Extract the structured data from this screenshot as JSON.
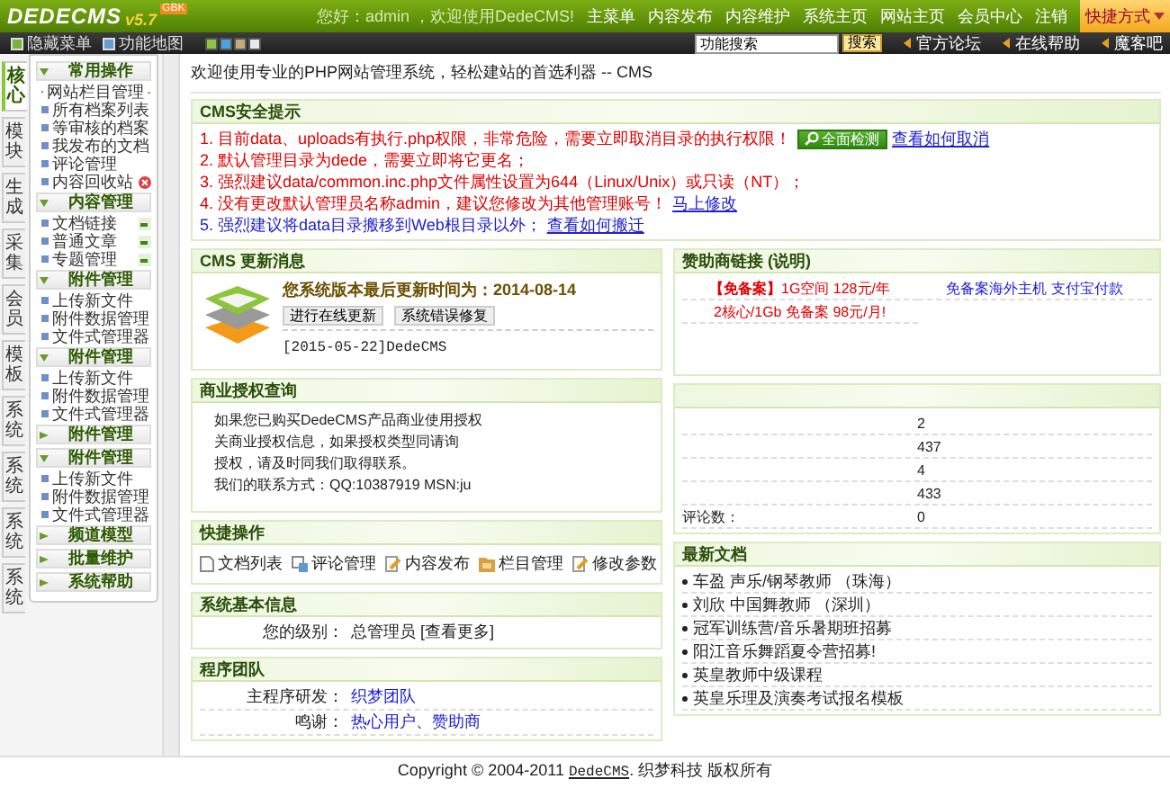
{
  "logo": {
    "name": "DEDECMS",
    "version": "v5.7",
    "edition": "GBK"
  },
  "greeting": "您好：admin ，欢迎使用DedeCMS!",
  "top_nav": [
    "主菜单",
    "内容发布",
    "内容维护",
    "系统主页",
    "网站主页",
    "会员中心",
    "注销"
  ],
  "shortcut_menu": "快捷方式",
  "toolbar": {
    "hide_menu": "隐藏菜单",
    "feature_map": "功能地图",
    "themes": [
      {
        "color": "#8cc63f"
      },
      {
        "color": "#4aa3df"
      },
      {
        "color": "#c8a878"
      },
      {
        "color": "#e8e8e8"
      }
    ],
    "search": {
      "value": "功能搜索",
      "button": "搜索"
    },
    "links": [
      "官方论坛",
      "在线帮助",
      "魔客吧"
    ]
  },
  "side_tabs": [
    {
      "label": "核心",
      "selected": true
    },
    {
      "label": "模块",
      "selected": false
    },
    {
      "label": "生成",
      "selected": false
    },
    {
      "label": "采集",
      "selected": false
    },
    {
      "label": "会员",
      "selected": false
    },
    {
      "label": "模板",
      "selected": false
    },
    {
      "label": "系统",
      "selected": false
    },
    {
      "label": "系统",
      "selected": false
    },
    {
      "label": "系统",
      "selected": false
    },
    {
      "label": "系统",
      "selected": false
    }
  ],
  "menu_groups": [
    {
      "title": "常用操作",
      "expanded": true,
      "items": [
        {
          "label": "网站栏目管理",
          "kind": "addable"
        },
        {
          "label": "所有档案列表",
          "kind": "plain"
        },
        {
          "label": "等审核的档案",
          "kind": "plain"
        },
        {
          "label": "我发布的文档",
          "kind": "plain"
        },
        {
          "label": "评论管理",
          "kind": "plain"
        },
        {
          "label": "内容回收站",
          "kind": "bin"
        }
      ]
    },
    {
      "title": "内容管理",
      "expanded": true,
      "items": [
        {
          "label": "文档链接",
          "kind": "addable"
        },
        {
          "label": "普通文章",
          "kind": "addable"
        },
        {
          "label": "专题管理",
          "kind": "addable"
        }
      ]
    },
    {
      "title": "附件管理",
      "expanded": true,
      "items": [
        {
          "label": "上传新文件"
        },
        {
          "label": "附件数据管理"
        },
        {
          "label": "文件式管理器"
        }
      ]
    },
    {
      "title": "附件管理",
      "expanded": true,
      "items": [
        {
          "label": "上传新文件"
        },
        {
          "label": "附件数据管理"
        },
        {
          "label": "文件式管理器"
        }
      ]
    },
    {
      "title": "附件管理",
      "expanded": false
    },
    {
      "title": "附件管理",
      "expanded": true,
      "items": [
        {
          "label": "上传新文件"
        },
        {
          "label": "附件数据管理"
        },
        {
          "label": "文件式管理器"
        }
      ]
    },
    {
      "title": "频道模型",
      "expanded": false
    },
    {
      "title": "批量维护",
      "expanded": false
    },
    {
      "title": "系统帮助",
      "expanded": false
    }
  ],
  "welcome": "欢迎使用专业的PHP网站管理系统，轻松建站的首选利器 -- CMS",
  "security": {
    "title": "CMS安全提示",
    "lines": [
      {
        "kind": "warning",
        "text": "1. 目前data、uploads有执行.php权限，非常危险，需要立即取消目录的执行权限！",
        "button": "全面检测",
        "link": "查看如何取消"
      },
      {
        "kind": "warning",
        "text": "2. 默认管理目录为dede，需要立即将它更名；"
      },
      {
        "kind": "warning",
        "text": "3. 强烈建议data/common.inc.php文件属性设置为644（Linux/Unix）或只读（NT）；"
      },
      {
        "kind": "warning",
        "text": "4. 没有更改默认管理员名称admin，建议您修改为其他管理账号！",
        "link": "马上修改"
      },
      {
        "kind": "notice",
        "text": "5. 强烈建议将data目录搬移到Web根目录以外；",
        "link": "查看如何搬迁"
      }
    ]
  },
  "update": {
    "title": "CMS 更新消息",
    "heading": "您系统版本最后更新时间为：2014-08-14",
    "buttons": [
      "进行在线更新",
      "系统错误修复"
    ],
    "log": "[2015-05-22]DedeCMS"
  },
  "license": {
    "title": "商业授权查询",
    "lines": [
      "如果您已购买DedeCMS产品商业使用授权",
      "关商业授权信息，如果授权类型同请询",
      "授权，请及时同我们取得联系。",
      "我们的联系方式：QQ:10387919 MSN:ju"
    ]
  },
  "quick_ops": {
    "title": "快捷操作",
    "items": [
      {
        "label": "文档列表",
        "kind": "document"
      },
      {
        "label": "评论管理",
        "kind": "comment"
      },
      {
        "label": "内容发布",
        "kind": "edit"
      },
      {
        "label": "栏目管理",
        "kind": "folder"
      },
      {
        "label": "修改参数",
        "kind": "edit"
      }
    ]
  },
  "system_info": {
    "title": "系统基本信息",
    "rows": [
      {
        "label": "您的级别：",
        "value": "总管理员 [查看更多]"
      }
    ]
  },
  "team": {
    "title": "程序团队",
    "rows": [
      {
        "label": "主程序研发：",
        "value": "织梦团队"
      },
      {
        "label": "鸣谢：",
        "value": "热心用户、赞助商"
      }
    ]
  },
  "sponsor": {
    "title": "赞助商链接",
    "title_note": "(说明)",
    "links": [
      {
        "kind": "offer",
        "tag": "【免备案】",
        "text": "1G空间 128元/年"
      },
      {
        "kind": "link",
        "text": "免备案海外主机 支付宝付款"
      },
      {
        "kind": "offer",
        "text": "2核心/1Gb 免备案 98元/月!"
      }
    ]
  },
  "stats": {
    "rows": [
      {
        "value": "2"
      },
      {
        "value": "437"
      },
      {
        "value": "4"
      },
      {
        "value": "433"
      },
      {
        "label": "评论数：",
        "value": "0"
      }
    ]
  },
  "latest": {
    "title": "最新文档",
    "items": [
      "车盈 声乐/钢琴教师 （珠海）",
      "刘欣 中国舞教师 （深圳）",
      "冠军训练营/音乐暑期班招募",
      "阳江音乐舞蹈夏令营招募!",
      "英皇教师中级课程",
      "英皇乐理及演奏考试报名模板"
    ]
  },
  "footer": {
    "prefix": "Copyright © 2004-2011 ",
    "link": "DedeCMS",
    "suffix": ". 织梦科技 版权所有"
  }
}
